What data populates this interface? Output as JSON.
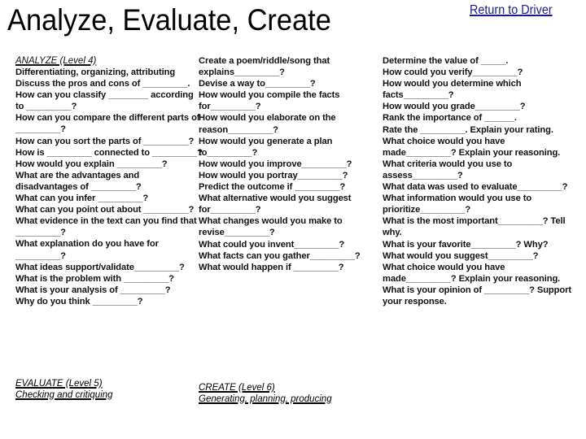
{
  "title": "Analyze, Evaluate, Create",
  "return_link": "Return to Driver",
  "analyze": {
    "heading": "ANALYZE (Level 4)",
    "items": [
      "Differentiating, organizing, attributing",
      "Discuss the pros and cons of _________.",
      "How can you classify ________ according to _________?",
      "How can you compare the different parts of _________?",
      "How can you sort the parts of _________?",
      "How is _________ connected to _________?",
      "How would you explain _________?",
      "What are the advantages and disadvantages of _________?",
      "What can you infer _________?",
      "What can you point out about _________?",
      "What evidence in the text can you find that _________?",
      "What explanation do you have for _________?",
      "What ideas support/validate_________?",
      "What is the problem with _________?",
      "What is your analysis of _________?",
      "Why do you think _________?"
    ]
  },
  "create": {
    "items": [
      "Create a poem/riddle/song that explains_________?",
      "Devise a way to_________?",
      "How would you compile the facts for_________?",
      "How would you elaborate on the reason_________?",
      "How would you generate a plan to_________?",
      "How would you improve_________?",
      "How would you portray_________?",
      "Predict the outcome if _________?",
      "What alternative would you suggest for_________?",
      "What changes would you make to revise_________?",
      "What could you invent_________?",
      "What facts can you gather_________?",
      "What would happen if _________?"
    ]
  },
  "evaluate": {
    "items": [
      "Determine the value of _____.",
      "How could you verify_________?",
      "How would you determine which facts_________?",
      "How would you grade_________?",
      "Rank the importance of ______.",
      "Rate the _________. Explain your rating.",
      "What choice would you have made_________? Explain your reasoning.",
      "What criteria would you use to assess_________?",
      "What data was used to evaluate_________?",
      "What information would you use to prioritize_________?",
      "What is the most important_________? Tell why.",
      "What is your favorite_________? Why?",
      "What would you suggest_________?",
      "What choice would you have made_________? Explain your reasoning.",
      "What is your opinion of _________? Support your response."
    ]
  },
  "level_headings": {
    "evaluate": {
      "title": "EVALUATE (Level 5)",
      "subtitle": "Checking and critiquing"
    },
    "create": {
      "title": "CREATE (Level 6)",
      "subtitle": "Generating, planning, producing"
    }
  }
}
